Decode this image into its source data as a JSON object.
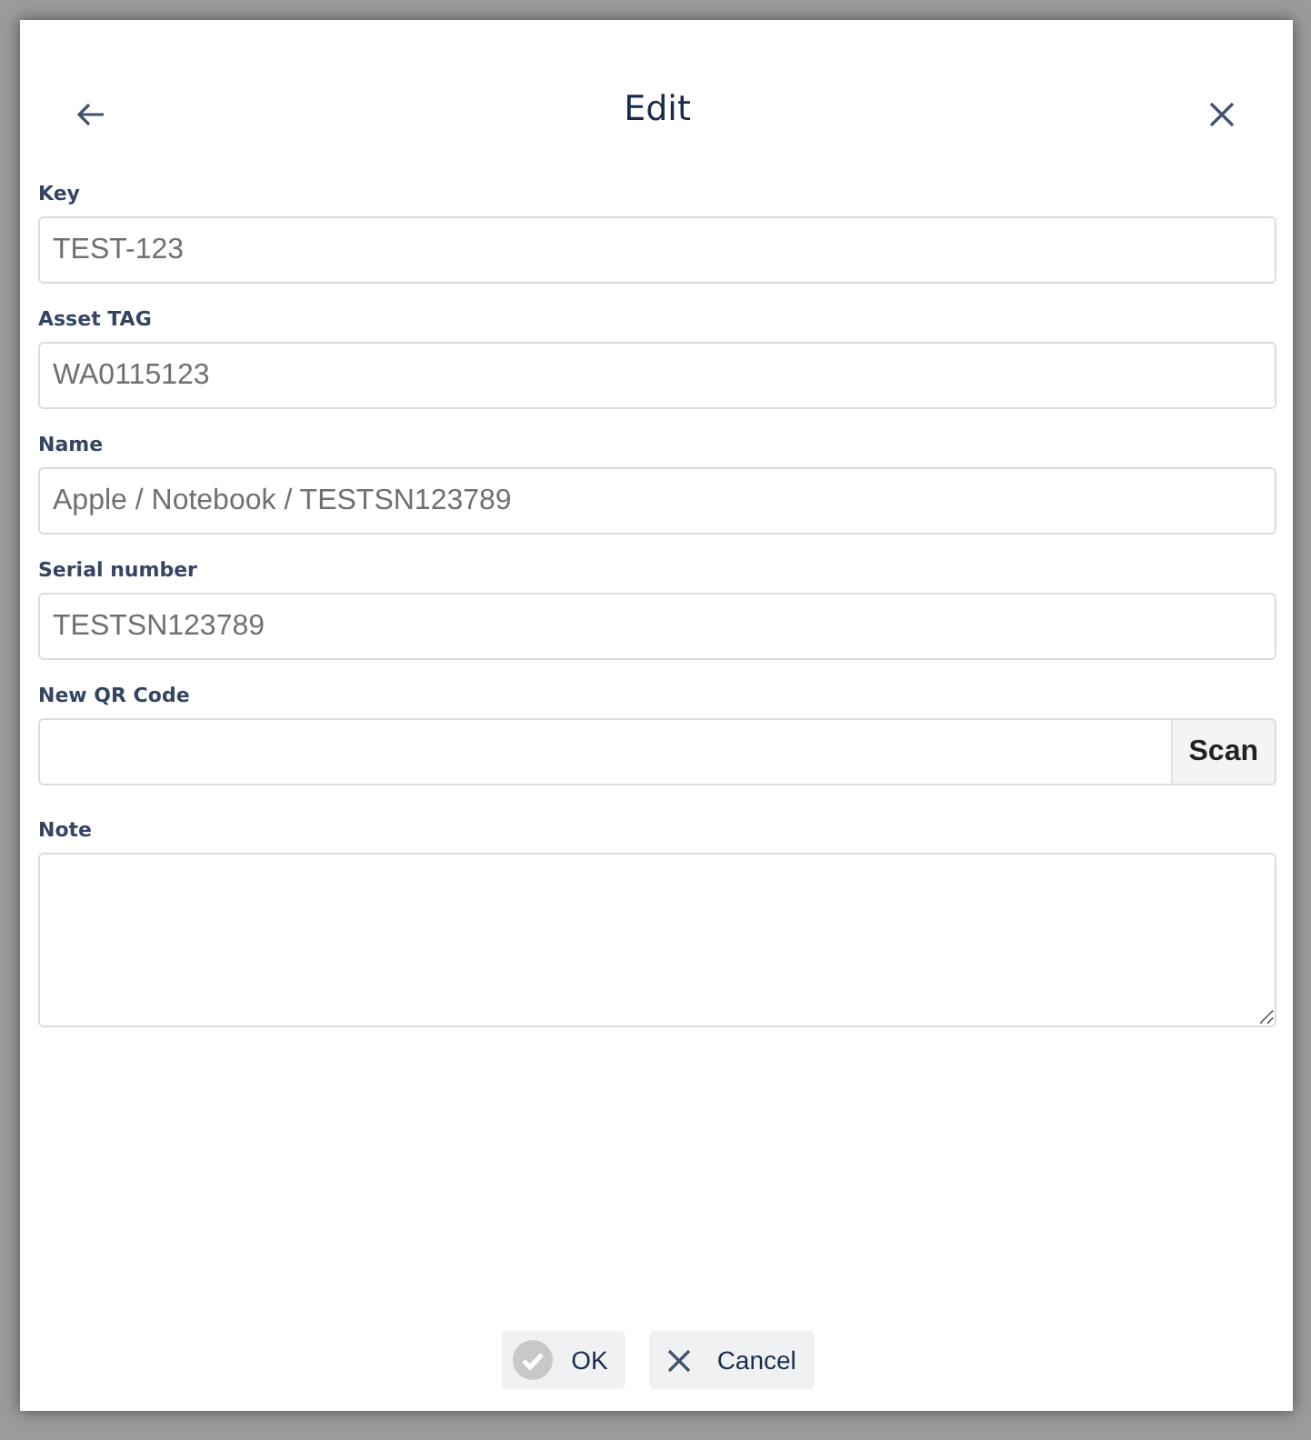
{
  "dialog": {
    "title": "Edit"
  },
  "fields": [
    {
      "kind": "text",
      "label": "Key",
      "value": "TEST-123"
    },
    {
      "kind": "text",
      "label": "Asset TAG",
      "value": "WA0115123"
    },
    {
      "kind": "text",
      "label": "Name",
      "value": "Apple / Notebook / TESTSN123789"
    },
    {
      "kind": "text",
      "label": "Serial number",
      "value": "TESTSN123789"
    },
    {
      "kind": "scan",
      "label": "New QR Code",
      "button": "Scan"
    },
    {
      "kind": "textarea",
      "label": "Note"
    }
  ],
  "buttons": [
    {
      "label": "OK",
      "kind": "ok"
    },
    {
      "label": "Cancel",
      "kind": "cancel"
    }
  ]
}
